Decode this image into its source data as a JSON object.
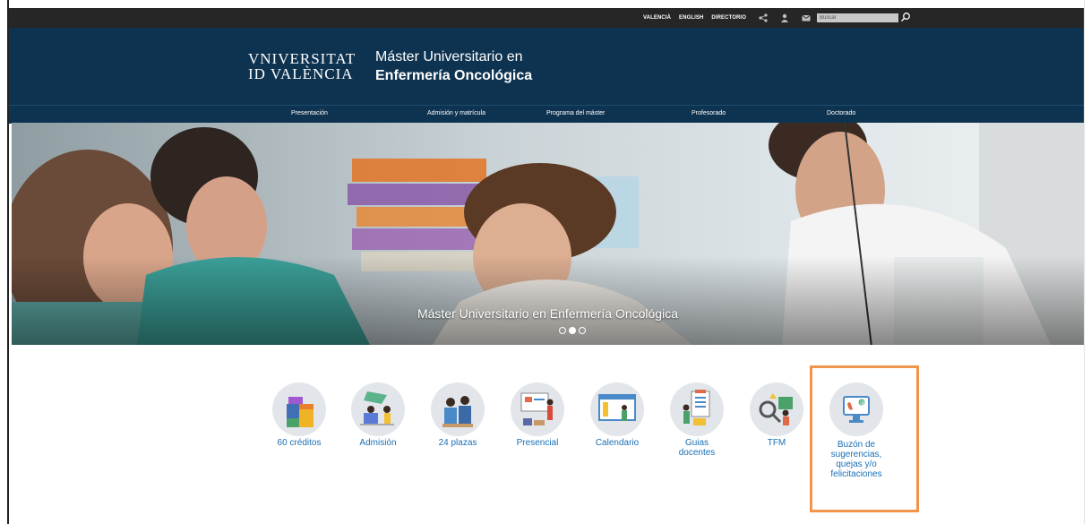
{
  "topbar": {
    "links": [
      "VALENCIÀ",
      "ENGLISH",
      "DIRECTORIO"
    ],
    "icons": [
      "share-icon",
      "user-icon",
      "mail-icon"
    ],
    "search_placeholder": "Buscar"
  },
  "header": {
    "logo_line1": "VNIVERSITAT",
    "logo_line2": "ID VALÈNCIA",
    "title_line1": "Máster Universitario en",
    "title_line2": "Enfermería Oncológica"
  },
  "nav": {
    "items": [
      "Presentación",
      "Admisión y matrícula",
      "Programa del máster",
      "Profesorado",
      "Doctorado"
    ]
  },
  "hero": {
    "caption": "Máster Universitario en Enfermería Oncológica",
    "slides_total": 3,
    "active_slide": 2
  },
  "quick_links": [
    {
      "label": "60 créditos",
      "icon": "books-icon"
    },
    {
      "label": "Admisión",
      "icon": "admission-icon"
    },
    {
      "label": "24 plazas",
      "icon": "students-icon"
    },
    {
      "label": "Presencial",
      "icon": "classroom-icon"
    },
    {
      "label": "Calendario",
      "icon": "calendar-icon"
    },
    {
      "label": "Guias docentes",
      "icon": "guides-icon"
    },
    {
      "label": "TFM",
      "icon": "research-icon"
    },
    {
      "label": "Buzón de sugerencias, quejas y/o felicitaciones",
      "icon": "mailbox-icon"
    }
  ],
  "colors": {
    "header_bg": "#0e3350",
    "topbar_bg": "#262626",
    "link_blue": "#1a6fb4",
    "highlight_orange": "#f0954a"
  }
}
